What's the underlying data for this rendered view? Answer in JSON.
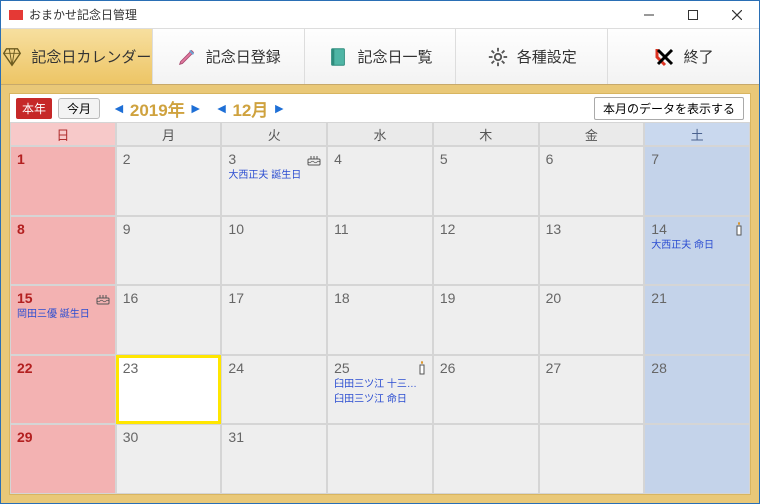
{
  "window": {
    "title": "おまかせ記念日管理"
  },
  "tabs": [
    {
      "label": "記念日カレンダー",
      "active": true,
      "icon": "diamond"
    },
    {
      "label": "記念日登録",
      "active": false,
      "icon": "pen"
    },
    {
      "label": "記念日一覧",
      "active": false,
      "icon": "book"
    },
    {
      "label": "各種設定",
      "active": false,
      "icon": "gear"
    },
    {
      "label": "終了",
      "active": false,
      "icon": "close-red"
    }
  ],
  "toolbar": {
    "this_year_badge": "本年",
    "this_month_btn": "今月",
    "year_label": "2019年",
    "month_label": "12月",
    "show_data_btn": "本月のデータを表示する"
  },
  "weekday_headers": [
    "日",
    "月",
    "火",
    "水",
    "木",
    "金",
    "土"
  ],
  "days": [
    {
      "n": "1",
      "type": "sun"
    },
    {
      "n": "2",
      "type": "wd"
    },
    {
      "n": "3",
      "type": "wd",
      "events": [
        "大西正夫 誕生日"
      ],
      "icon": "cake"
    },
    {
      "n": "4",
      "type": "wd"
    },
    {
      "n": "5",
      "type": "wd"
    },
    {
      "n": "6",
      "type": "wd"
    },
    {
      "n": "7",
      "type": "sat"
    },
    {
      "n": "8",
      "type": "sun"
    },
    {
      "n": "9",
      "type": "wd"
    },
    {
      "n": "10",
      "type": "wd"
    },
    {
      "n": "11",
      "type": "wd"
    },
    {
      "n": "12",
      "type": "wd"
    },
    {
      "n": "13",
      "type": "wd"
    },
    {
      "n": "14",
      "type": "sat",
      "events": [
        "大西正夫 命日"
      ],
      "icon": "candle"
    },
    {
      "n": "15",
      "type": "sun",
      "events": [
        "岡田三優 誕生日"
      ],
      "icon": "cake"
    },
    {
      "n": "16",
      "type": "wd"
    },
    {
      "n": "17",
      "type": "wd"
    },
    {
      "n": "18",
      "type": "wd"
    },
    {
      "n": "19",
      "type": "wd"
    },
    {
      "n": "20",
      "type": "wd"
    },
    {
      "n": "21",
      "type": "sat"
    },
    {
      "n": "22",
      "type": "sun"
    },
    {
      "n": "23",
      "type": "wd",
      "today": true
    },
    {
      "n": "24",
      "type": "wd"
    },
    {
      "n": "25",
      "type": "wd",
      "events": [
        "臼田三ツ江 十三回忌",
        "臼田三ツ江 命日"
      ],
      "icon": "candle"
    },
    {
      "n": "26",
      "type": "wd"
    },
    {
      "n": "27",
      "type": "wd"
    },
    {
      "n": "28",
      "type": "sat"
    },
    {
      "n": "29",
      "type": "sun"
    },
    {
      "n": "30",
      "type": "wd"
    },
    {
      "n": "31",
      "type": "wd"
    },
    {
      "n": "",
      "type": "wd"
    },
    {
      "n": "",
      "type": "wd"
    },
    {
      "n": "",
      "type": "wd"
    },
    {
      "n": "",
      "type": "sat"
    }
  ]
}
